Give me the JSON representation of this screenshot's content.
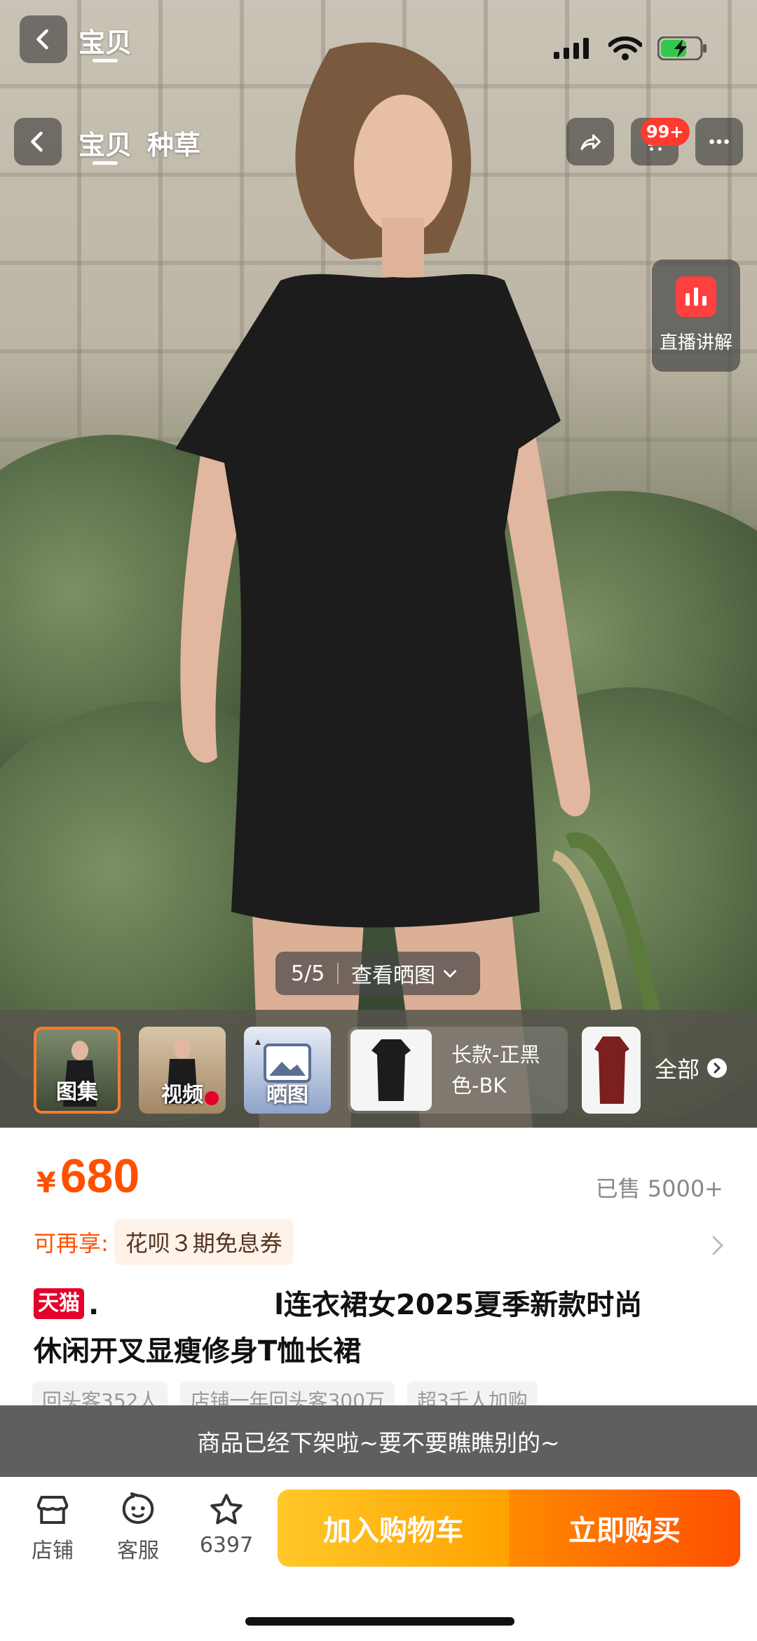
{
  "header": {
    "ghost_tab": "宝贝",
    "tabs": [
      "宝贝",
      "种草"
    ],
    "cart_badge": "99+"
  },
  "live": {
    "label": "直播讲解"
  },
  "gallery": {
    "counter": "5/5",
    "view_reviews": "查看晒图",
    "thumbs": [
      "图集",
      "视频",
      "晒图"
    ],
    "variant_text": "长款-正黑色-BK",
    "all_label": "全部"
  },
  "product": {
    "currency": "¥",
    "price": "680",
    "sold": "已售 5000+",
    "promo_label": "可再享:",
    "promo_coupon": "花呗３期免息券",
    "tmall_tag": "天猫",
    "title_line1_start": ".",
    "title_line1_end": "l连衣裙女2025夏季新款时尚",
    "title_line2": "休闲开叉显瘦修身T恤长裙",
    "chips": [
      "回头客352人",
      "店铺一年回头客300万",
      "超3千人加购"
    ]
  },
  "toast": "商品已经下架啦~要不要瞧瞧别的~",
  "bottom": {
    "store": "店铺",
    "service": "客服",
    "favorites_count": "6397",
    "add_to_cart": "加入购物车",
    "buy_now": "立即购买"
  },
  "colors": {
    "accent": "#ff5000",
    "cart_gradient_start": "#ffc828",
    "buy_gradient_end": "#ff5000",
    "tmall_red": "#e4002b"
  }
}
